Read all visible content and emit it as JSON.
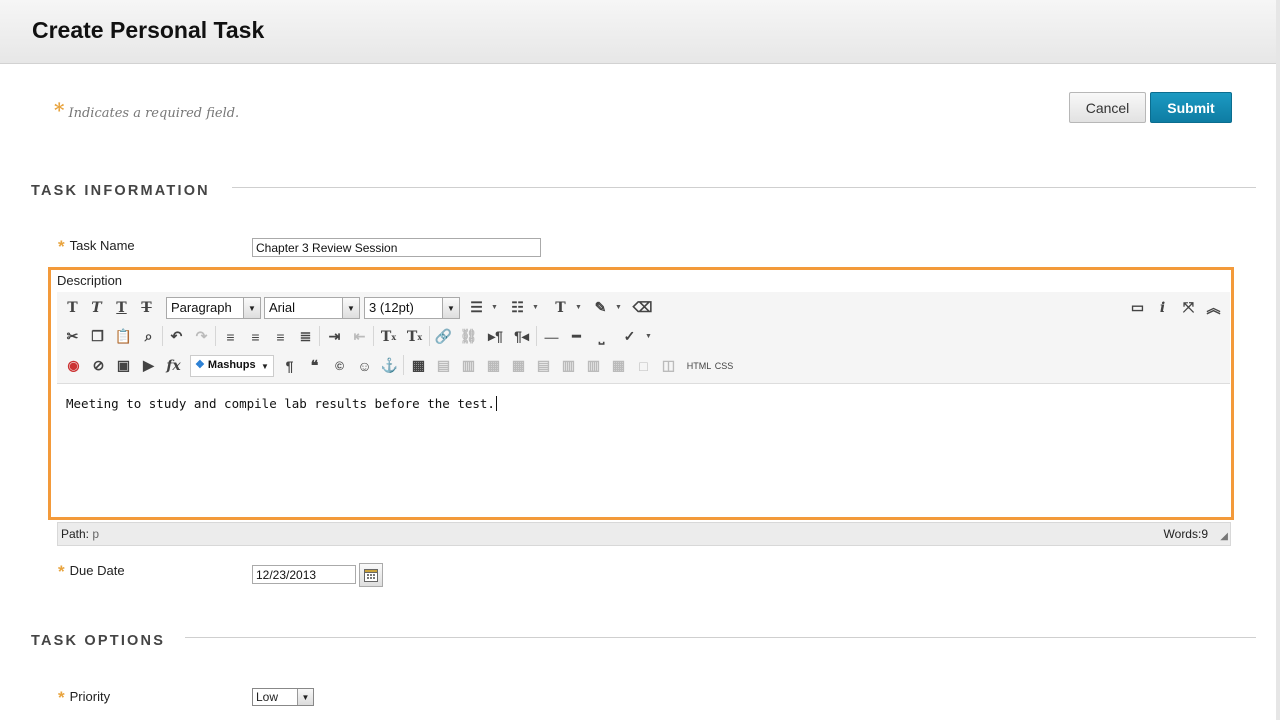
{
  "page": {
    "title": "Create Personal Task"
  },
  "required_note": {
    "star": "*",
    "text": "Indicates a required field."
  },
  "actions": {
    "cancel_label": "Cancel",
    "submit_label": "Submit"
  },
  "task_information": {
    "heading": "TASK INFORMATION",
    "task_name": {
      "label": "Task Name",
      "value": "Chapter 3 Review Session"
    },
    "description": {
      "label": "Description",
      "toolbar": {
        "format_select": "Paragraph",
        "font_select": "Arial",
        "size_select": "3 (12pt)",
        "mashups_label": "Mashups",
        "html_label": "HTML",
        "css_label": "CSS"
      },
      "content": "Meeting to study and compile lab results before the test.",
      "path_label": "Path:",
      "path_value": "p",
      "words_label": "Words:9"
    },
    "due_date": {
      "label": "Due Date",
      "value": "12/23/2013"
    }
  },
  "task_options": {
    "heading": "TASK OPTIONS",
    "priority": {
      "label": "Priority",
      "value": "Low"
    }
  },
  "colors": {
    "accent_submit": "#1189b3",
    "highlight": "#f39a3a",
    "required": "#e8a33d"
  }
}
